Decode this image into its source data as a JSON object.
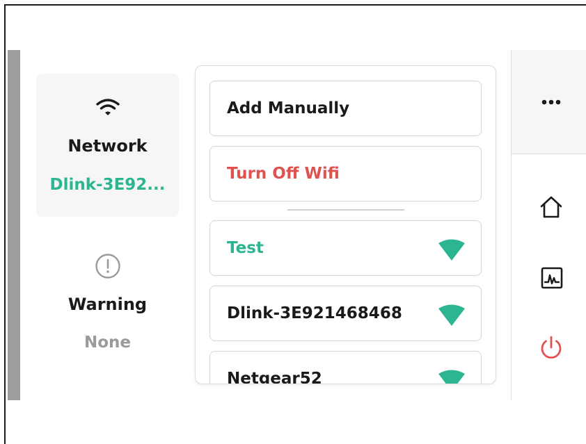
{
  "colors": {
    "accent_green": "#2bb590",
    "danger_red": "#e0524f",
    "muted_gray": "#9a9a9a",
    "text_dark": "#1a1a1a"
  },
  "status": {
    "network": {
      "icon": "wifi-icon",
      "title": "Network",
      "value": "Dlink-3E92..."
    },
    "warning": {
      "icon": "warning-circle-icon",
      "title": "Warning",
      "value": "None"
    }
  },
  "menu": {
    "actions": [
      {
        "label": "Add Manually"
      },
      {
        "label": "Turn Off Wifi"
      }
    ],
    "networks": [
      {
        "ssid": "Test",
        "connected": true,
        "icon": "wifi-signal-icon"
      },
      {
        "ssid": "Dlink-3E921468468",
        "connected": false,
        "icon": "wifi-signal-icon"
      },
      {
        "ssid": "Netgear52",
        "connected": false,
        "icon": "wifi-signal-icon"
      }
    ]
  },
  "sidebar_right": {
    "icons": [
      "more-icon",
      "home-icon",
      "chart-icon",
      "power-icon"
    ]
  }
}
